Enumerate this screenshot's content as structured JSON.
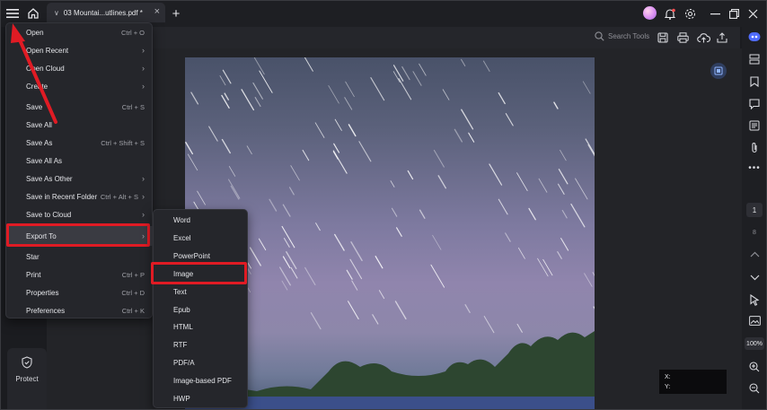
{
  "tab": {
    "title": "03 Mountai...utlines.pdf *"
  },
  "toolbar": {
    "search_label": "Search Tools"
  },
  "left_rail": {
    "protect_label": "Protect"
  },
  "right_rail": {
    "page_current": "1",
    "page_total": "8",
    "zoom": "100%"
  },
  "menu": {
    "items": [
      {
        "label": "Open",
        "shortcut": "Ctrl + O"
      },
      {
        "label": "Open Recent",
        "shortcut": ""
      },
      {
        "label": "Open Cloud",
        "shortcut": ""
      },
      {
        "label": "Create",
        "shortcut": ""
      },
      {
        "label": "Save",
        "shortcut": "Ctrl + S"
      },
      {
        "label": "Save All",
        "shortcut": ""
      },
      {
        "label": "Save As",
        "shortcut": "Ctrl + Shift + S"
      },
      {
        "label": "Save All As",
        "shortcut": ""
      },
      {
        "label": "Save As Other",
        "shortcut": ""
      },
      {
        "label": "Save in Recent Folder",
        "shortcut": "Ctrl + Alt + S"
      },
      {
        "label": "Save to Cloud",
        "shortcut": ""
      },
      {
        "label": "Export To",
        "shortcut": ""
      },
      {
        "label": "Star",
        "shortcut": ""
      },
      {
        "label": "Print",
        "shortcut": "Ctrl + P"
      },
      {
        "label": "Properties",
        "shortcut": "Ctrl + D"
      },
      {
        "label": "Preferences",
        "shortcut": "Ctrl + K"
      }
    ]
  },
  "submenu": {
    "items": [
      "Word",
      "Excel",
      "PowerPoint",
      "Image",
      "Text",
      "Epub",
      "HTML",
      "RTF",
      "PDF/A",
      "Image-based PDF",
      "HWP"
    ]
  },
  "coords": {
    "x_label": "X:",
    "y_label": "Y:"
  },
  "colors": {
    "highlight": "#e01b24",
    "accent": "#4f6bff"
  }
}
